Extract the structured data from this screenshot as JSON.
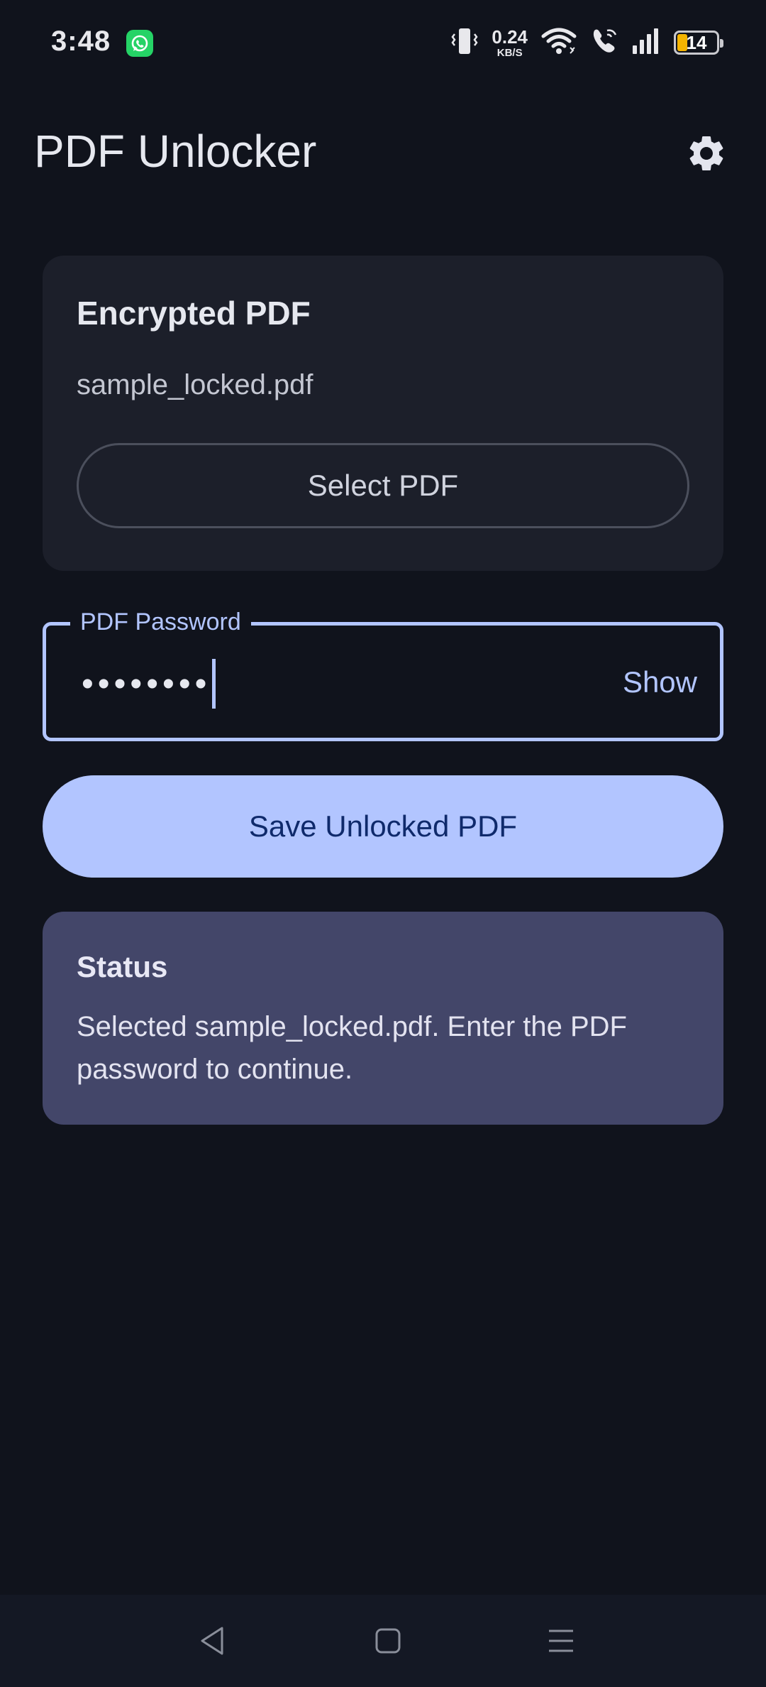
{
  "status_bar": {
    "time": "3:48",
    "net_speed_value": "0.24",
    "net_speed_unit": "KB/S",
    "battery_level": "14",
    "icons": [
      "whatsapp-icon",
      "vibrate-icon",
      "wifi-icon",
      "wifi-call-icon",
      "signal-icon",
      "battery-icon"
    ]
  },
  "app_bar": {
    "title": "PDF Unlocker",
    "settings_icon": "gear-icon"
  },
  "file_card": {
    "title": "Encrypted PDF",
    "file_name": "sample_locked.pdf",
    "select_button": "Select PDF"
  },
  "password_field": {
    "label": "PDF Password",
    "value_masked": "••••••••",
    "toggle_label": "Show"
  },
  "primary_action": {
    "label": "Save Unlocked PDF"
  },
  "status_card": {
    "title": "Status",
    "message": "Selected sample_locked.pdf. Enter the PDF password to continue."
  },
  "nav_bar": {
    "items": [
      "back-icon",
      "home-icon",
      "recents-icon"
    ]
  },
  "colors": {
    "background": "#10131c",
    "card": "#1c1f2a",
    "accent": "#b2c5ff",
    "status_card": "#434669"
  }
}
